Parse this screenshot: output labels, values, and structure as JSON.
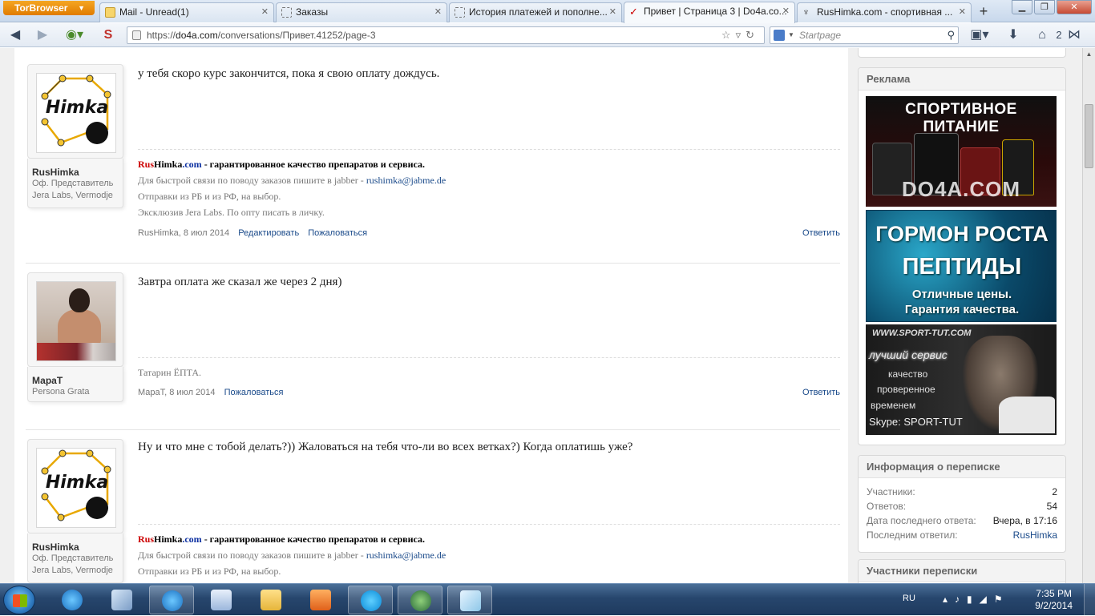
{
  "browser": {
    "menu_button": "TorBrowser",
    "tabs": [
      {
        "title": "Mail - Unread(1)",
        "icon": "mail-icon"
      },
      {
        "title": "Заказы",
        "icon": "page-icon"
      },
      {
        "title": "История платежей и пополне...",
        "icon": "page-icon"
      },
      {
        "title": "Привет | Страница 3 | Do4a.co...",
        "icon": "do4a-icon"
      },
      {
        "title": "RusHimka.com - спортивная ...",
        "icon": "barbell-icon"
      }
    ],
    "url_scheme": "https://",
    "url_host": "do4a.com",
    "url_path": "/conversations/Привет.41252/page-3",
    "search_placeholder": "Startpage",
    "badge": "2"
  },
  "posts": [
    {
      "username": "RusHimka",
      "title_line1": "Оф. Представитель",
      "title_line2": "Jera Labs, Vermodje",
      "text": "у тебя скоро курс закончится, пока я свою оплату дождусь.",
      "signature": {
        "brand_rus": "Rus",
        "brand_himka": "Himka",
        "brand_com": ".com",
        "tagline": " - гарантированное качество препаратов и сервиса.",
        "line2_prefix": "Для быстрой связи по поводу заказов пишите в jabber - ",
        "line2_link": "rushimka@jabme.de",
        "line3": "Отправки из РБ и из РФ, на выбор.",
        "line4": "Эксклюзив Jera Labs. По опту писать в личку."
      },
      "meta": "RusHimka, 8 июл 2014",
      "edit": "Редактировать",
      "report": "Пожаловаться",
      "reply": "Ответить"
    },
    {
      "username": "МараТ",
      "title_line1": "Persona Grata",
      "text": "Завтра оплата же сказал же через 2 дня)",
      "signature_plain": "Татарин ЁПТА.",
      "meta": "МараТ, 8 июл 2014",
      "report": "Пожаловаться",
      "reply": "Ответить"
    },
    {
      "username": "RusHimka",
      "title_line1": "Оф. Представитель",
      "title_line2": "Jera Labs, Vermodje",
      "text": "Ну и что мне с тобой делать?)) Жаловаться на тебя что-ли во всех ветках?) Когда оплатишь уже?",
      "signature": {
        "brand_rus": "Rus",
        "brand_himka": "Himka",
        "brand_com": ".com",
        "tagline": " - гарантированное качество препаратов и сервиса.",
        "line2_prefix": "Для быстрой связи по поводу заказов пишите в jabber - ",
        "line2_link": "rushimka@jabme.de",
        "line3": "Отправки из РБ и из РФ, на выбор."
      }
    }
  ],
  "logo_text": "Himka",
  "sidebar": {
    "ads_title": "Реклама",
    "ad1": {
      "title": "СПОРТИВНОЕ ПИТАНИЕ",
      "watermark": "DO4A.COM"
    },
    "ad2": {
      "line1": "ГОРМОН РОСТА",
      "line2": "ПЕПТИДЫ",
      "line3": "Отличные цены.",
      "line4": "Гарантия качества."
    },
    "ad3": {
      "site": "WWW.SPORT-TUT.COM",
      "best": "лучший сервис",
      "l1": "качество",
      "l2": "проверенное",
      "l3": "временем",
      "skype": "Skype: SPORT-TUT"
    },
    "info_title": "Информация о переписке",
    "info": [
      {
        "label": "Участники:",
        "value": "2"
      },
      {
        "label": "Ответов:",
        "value": "54"
      },
      {
        "label": "Дата последнего ответа:",
        "value": "Вчера, в 17:16"
      },
      {
        "label": "Последним ответил:",
        "value": "RusHimka"
      }
    ],
    "participants_title": "Участники переписки"
  },
  "taskbar": {
    "lang": "RU",
    "time": "7:35 PM",
    "date": "9/2/2014"
  }
}
